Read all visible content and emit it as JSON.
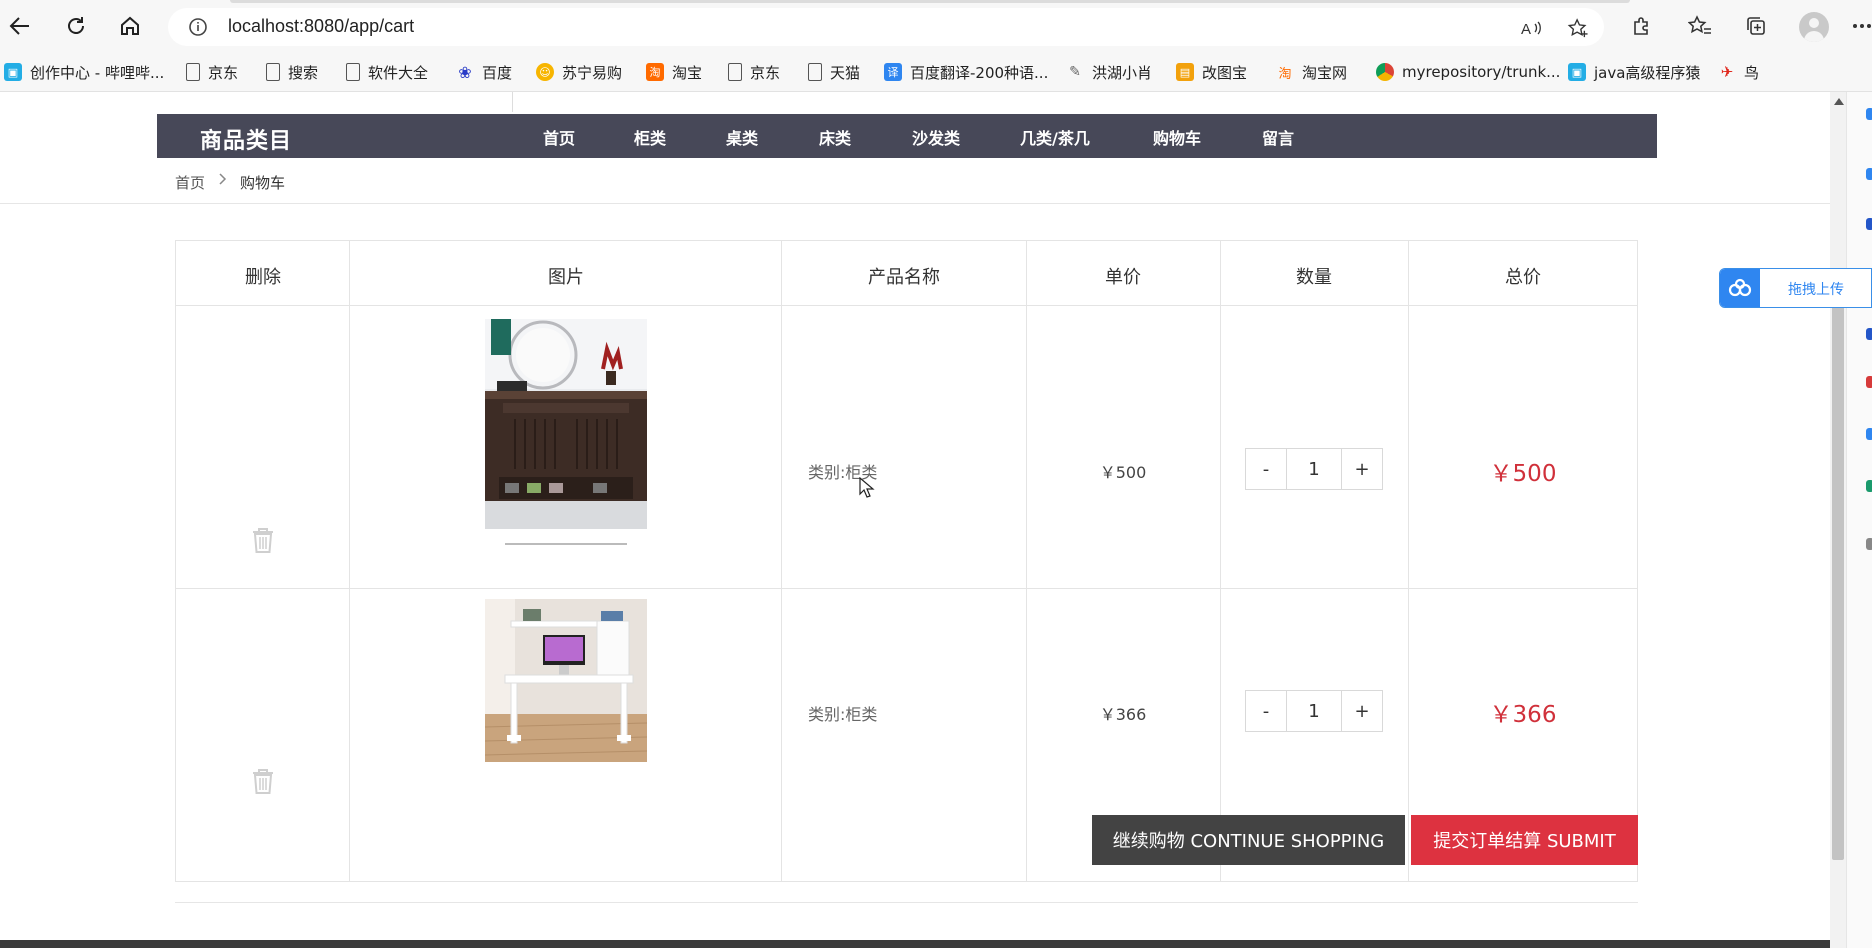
{
  "browser": {
    "url": "localhost:8080/app/cart",
    "bookmarks": [
      "创作中心 - 哔哩哔...",
      "京东",
      "搜索",
      "软件大全",
      "百度",
      "苏宁易购",
      "淘宝",
      "京东",
      "天猫",
      "百度翻译-200种语...",
      "洪湖小肖",
      "改图宝",
      "淘宝网",
      "myrepository/trunk...",
      "java高级程序猿",
      "鸟"
    ]
  },
  "header": {
    "category_title": "商品类目",
    "nav": [
      "首页",
      "柜类",
      "桌类",
      "床类",
      "沙发类",
      "几类/茶几",
      "购物车",
      "留言"
    ]
  },
  "breadcrumb": {
    "home": "首页",
    "separator": ">",
    "current": "购物车"
  },
  "cart": {
    "columns": [
      "删除",
      "图片",
      "产品名称",
      "单价",
      "数量",
      "总价"
    ],
    "rows": [
      {
        "name": "类别:柜类",
        "unit_price": "￥500",
        "qty": "1",
        "total": "￥500",
        "image": "dark-wood-shoe-cabinet",
        "image_caption": ""
      },
      {
        "name": "类别:柜类",
        "unit_price": "￥366",
        "qty": "1",
        "total": "￥366",
        "image": "white-computer-desk"
      }
    ],
    "qty_minus": "-",
    "qty_plus": "+"
  },
  "actions": {
    "continue": "继续购物 CONTINUE SHOPPING",
    "submit": "提交订单结算 SUBMIT"
  },
  "side_widget": {
    "upload": "拖拽上传"
  },
  "colors": {
    "navbar": "#474858",
    "price": "#d0303a",
    "submit": "#dd3240",
    "continue": "#434343"
  }
}
